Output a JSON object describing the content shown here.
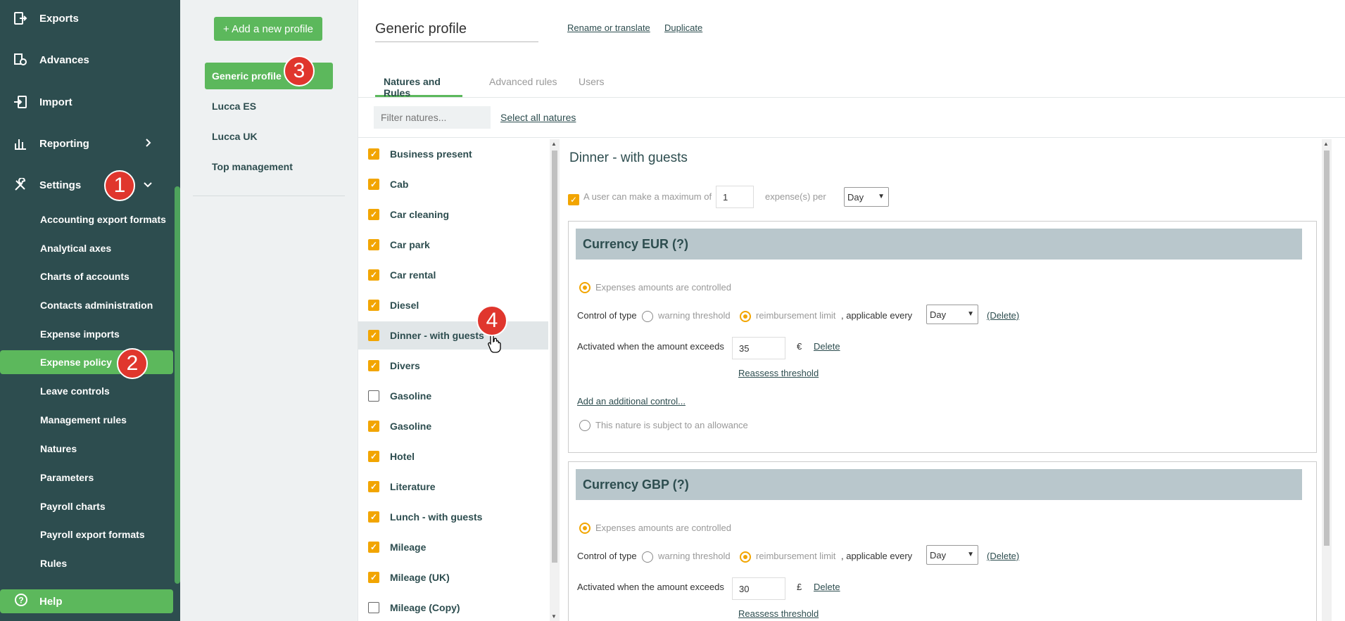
{
  "sidebar": {
    "main_items": [
      {
        "label": "Exports",
        "icon": "exports-icon"
      },
      {
        "label": "Advances",
        "icon": "advances-icon"
      },
      {
        "label": "Import",
        "icon": "import-icon"
      },
      {
        "label": "Reporting",
        "icon": "reporting-icon"
      },
      {
        "label": "Settings",
        "icon": "settings-icon"
      }
    ],
    "sub_items": [
      "Accounting export formats",
      "Analytical axes",
      "Charts of accounts",
      "Contacts administration",
      "Expense imports",
      "Expense policy",
      "Leave controls",
      "Management rules",
      "Natures",
      "Parameters",
      "Payroll charts",
      "Payroll export formats",
      "Rules"
    ],
    "active_sub": "Expense policy",
    "help_label": "Help"
  },
  "profiles": {
    "add_button": "+ Add a new profile",
    "items": [
      "Generic profile",
      "Lucca ES",
      "Lucca UK",
      "Top management"
    ],
    "active": "Generic profile"
  },
  "main": {
    "profile_title": "Generic profile",
    "rename_link": "Rename or translate",
    "duplicate_link": "Duplicate",
    "tabs": [
      "Natures and Rules",
      "Advanced rules",
      "Users"
    ],
    "filter_placeholder": "Filter natures...",
    "select_all": "Select all natures"
  },
  "natures": [
    {
      "label": "Business present",
      "checked": true
    },
    {
      "label": "Cab",
      "checked": true
    },
    {
      "label": "Car cleaning",
      "checked": true
    },
    {
      "label": "Car park",
      "checked": true
    },
    {
      "label": "Car rental",
      "checked": true
    },
    {
      "label": "Diesel",
      "checked": true
    },
    {
      "label": "Dinner - with guests",
      "checked": true
    },
    {
      "label": "Divers",
      "checked": true
    },
    {
      "label": "Gasoline",
      "checked": false
    },
    {
      "label": "Gasoline",
      "checked": true
    },
    {
      "label": "Hotel",
      "checked": true
    },
    {
      "label": "Literature",
      "checked": true
    },
    {
      "label": "Lunch - with guests",
      "checked": true
    },
    {
      "label": "Mileage",
      "checked": true
    },
    {
      "label": "Mileage (UK)",
      "checked": true
    },
    {
      "label": "Mileage (Copy)",
      "checked": false
    }
  ],
  "detail": {
    "title": "Dinner - with guests",
    "max_prefix": "A user can make a maximum of",
    "max_value": "1",
    "max_suffix": "expense(s) per",
    "max_period": "Day",
    "currencies": [
      {
        "heading": "Currency EUR (?)",
        "controlled_label": "Expenses amounts are controlled",
        "control_type_label": "Control of type",
        "warning_label": "warning threshold",
        "reimbursement_label": "reimbursement limit",
        "applicable_label": ", applicable every",
        "period": "Day",
        "delete_paren": "(Delete)",
        "exceeds_label": "Activated when the amount exceeds",
        "amount": "35",
        "symbol": "€",
        "delete_link": "Delete",
        "reassess_link": "Reassess threshold",
        "add_control_link": "Add an additional control...",
        "allowance_label": "This nature is subject to an allowance"
      },
      {
        "heading": "Currency GBP (?)",
        "controlled_label": "Expenses amounts are controlled",
        "control_type_label": "Control of type",
        "warning_label": "warning threshold",
        "reimbursement_label": "reimbursement limit",
        "applicable_label": ", applicable every",
        "period": "Day",
        "delete_paren": "(Delete)",
        "exceeds_label": "Activated when the amount exceeds",
        "amount": "30",
        "symbol": "£",
        "delete_link": "Delete",
        "reassess_link": "Reassess threshold"
      }
    ]
  },
  "badges": [
    "1",
    "2",
    "3",
    "4"
  ],
  "colors": {
    "sidebar_bg": "#2d4d4f",
    "accent_green": "#5cb85c",
    "checkbox_orange": "#f2a500",
    "badge_red": "#e0362d",
    "currency_header": "#b9c7cc"
  }
}
